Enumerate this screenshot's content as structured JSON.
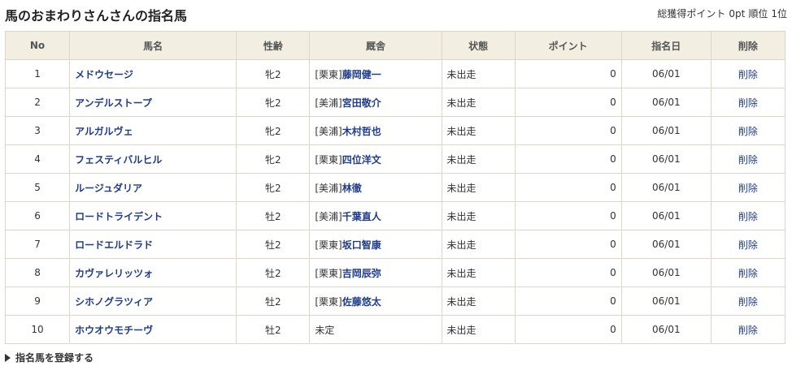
{
  "header": {
    "title": "馬のおまわりさんさんの指名馬",
    "total_points_label": "総獲得ポイント",
    "total_points": "0pt",
    "rank_label": "順位",
    "rank": "1位"
  },
  "table": {
    "columns": [
      "No",
      "馬名",
      "性齢",
      "厩舎",
      "状態",
      "ポイント",
      "指名日",
      "削除"
    ],
    "rows": [
      {
        "no": "1",
        "name": "メドウセージ",
        "sex_age": "牝2",
        "region": "[栗東]",
        "trainer": "藤岡健一",
        "status": "未出走",
        "points": "0",
        "date": "06/01",
        "delete": "削除"
      },
      {
        "no": "2",
        "name": "アンデルストープ",
        "sex_age": "牝2",
        "region": "[美浦]",
        "trainer": "宮田敬介",
        "status": "未出走",
        "points": "0",
        "date": "06/01",
        "delete": "削除"
      },
      {
        "no": "3",
        "name": "アルガルヴェ",
        "sex_age": "牝2",
        "region": "[美浦]",
        "trainer": "木村哲也",
        "status": "未出走",
        "points": "0",
        "date": "06/01",
        "delete": "削除"
      },
      {
        "no": "4",
        "name": "フェスティバルヒル",
        "sex_age": "牝2",
        "region": "[栗東]",
        "trainer": "四位洋文",
        "status": "未出走",
        "points": "0",
        "date": "06/01",
        "delete": "削除"
      },
      {
        "no": "5",
        "name": "ルージュダリア",
        "sex_age": "牝2",
        "region": "[美浦]",
        "trainer": "林徹",
        "status": "未出走",
        "points": "0",
        "date": "06/01",
        "delete": "削除"
      },
      {
        "no": "6",
        "name": "ロードトライデント",
        "sex_age": "牡2",
        "region": "[美浦]",
        "trainer": "千葉直人",
        "status": "未出走",
        "points": "0",
        "date": "06/01",
        "delete": "削除"
      },
      {
        "no": "7",
        "name": "ロードエルドラド",
        "sex_age": "牡2",
        "region": "[栗東]",
        "trainer": "坂口智康",
        "status": "未出走",
        "points": "0",
        "date": "06/01",
        "delete": "削除"
      },
      {
        "no": "8",
        "name": "カヴァレリッツォ",
        "sex_age": "牡2",
        "region": "[栗東]",
        "trainer": "吉岡辰弥",
        "status": "未出走",
        "points": "0",
        "date": "06/01",
        "delete": "削除"
      },
      {
        "no": "9",
        "name": "シホノグラツィア",
        "sex_age": "牡2",
        "region": "[栗東]",
        "trainer": "佐藤悠太",
        "status": "未出走",
        "points": "0",
        "date": "06/01",
        "delete": "削除"
      },
      {
        "no": "10",
        "name": "ホウオウモチーヴ",
        "sex_age": "牡2",
        "region": "",
        "trainer": "未定",
        "status": "未出走",
        "points": "0",
        "date": "06/01",
        "delete": "削除"
      }
    ]
  },
  "footer": {
    "register_label": "指名馬を登録する"
  }
}
